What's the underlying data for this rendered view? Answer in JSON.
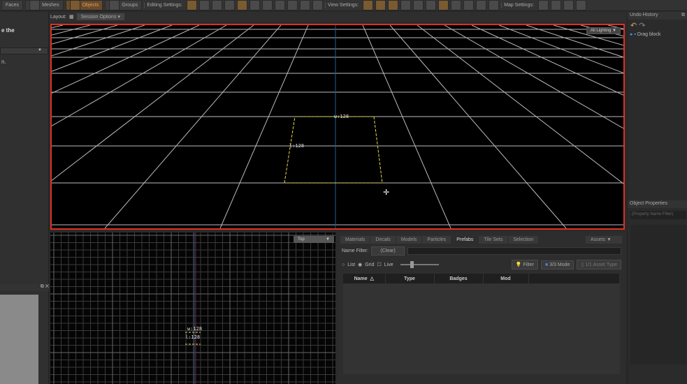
{
  "toolbar": {
    "modes": [
      "Faces",
      "Meshes",
      "Objects",
      "Groups"
    ],
    "active_mode": "Objects",
    "editing_label": "Editing Settings:",
    "view_label": "View Settings:",
    "map_label": "Map Settings:"
  },
  "layout": {
    "label": "Layout:",
    "session": "Session Options"
  },
  "left_panel": {
    "text1": "e the",
    "text2": "n."
  },
  "viewport3d": {
    "lighting": "All Lighting",
    "width_label": "w:128",
    "length_label": "l:128"
  },
  "viewport2d": {
    "view": "Top",
    "width_label": "w:128",
    "length_label": "l:128"
  },
  "assets": {
    "tabs": [
      "Materials",
      "Decals",
      "Models",
      "Particles",
      "Prefabs",
      "Tile Sets",
      "Selection"
    ],
    "active_tab": "Prefabs",
    "dropdown": "Assets",
    "name_filter_label": "Name Filter:",
    "clear": "(Clear)",
    "list": "List",
    "grid": "Grid",
    "live": "Live",
    "filter": "Filter",
    "mode": "3/3 Mode",
    "asset_type": "1/1 Asset Type",
    "columns": [
      "Name",
      "Type",
      "Badges",
      "Mod"
    ]
  },
  "undo": {
    "title": "Undo History",
    "items": [
      "Drag block"
    ]
  },
  "object_properties": {
    "title": "Object Properties",
    "placeholder": "(Property Name Filter)"
  },
  "colors": {
    "selection": "#e03020",
    "accent": "#d8a060"
  }
}
